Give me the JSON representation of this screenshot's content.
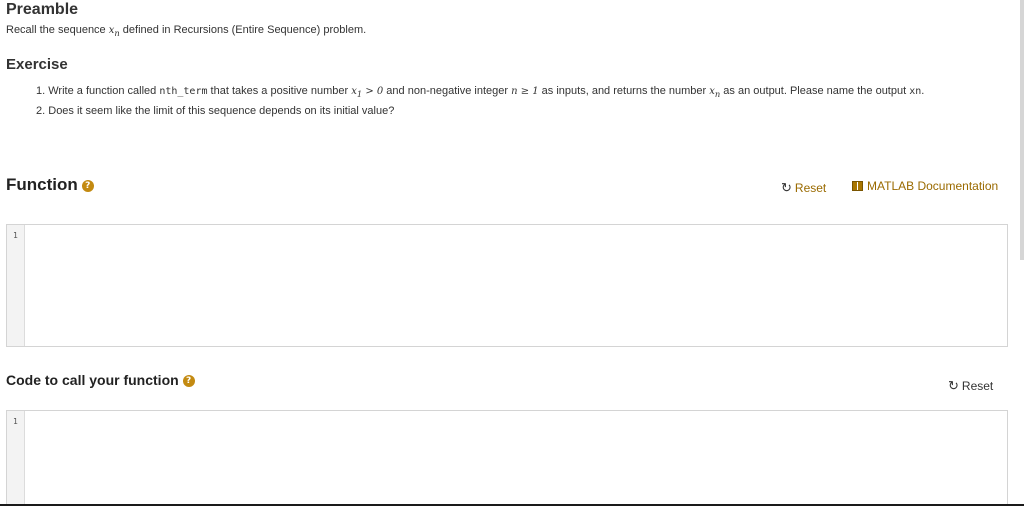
{
  "preamble": {
    "title": "Preamble",
    "text_before": "Recall the sequence ",
    "math_x": "x",
    "math_sub": "n",
    "text_after": " defined in Recursions (Entire Sequence) problem."
  },
  "exercise": {
    "title": "Exercise",
    "item1": {
      "num": "1.",
      "t1": "Write a function called ",
      "code": "nth_term",
      "t2": " that takes a positive number ",
      "m1": "x",
      "m1sub": "1",
      "m1rest": " > 0",
      "t3": " and non-negative integer ",
      "m2": "n ≥ 1",
      "t4": " as inputs, and returns the number ",
      "m3": "x",
      "m3sub": "n",
      "t5": " as an output.  Please name the output ",
      "code2": "xn",
      "t6": "."
    },
    "item2": {
      "num": "2.",
      "text": "Does it seem like the limit of this sequence depends on its initial value?"
    }
  },
  "function_section": {
    "title": "Function",
    "help": "?",
    "reset_label": "Reset",
    "doc_label": "MATLAB Documentation",
    "line_number": "1",
    "code": ""
  },
  "call_section": {
    "title": "Code to call your function",
    "help": "?",
    "reset_label": "Reset",
    "line_number": "1",
    "code": ""
  },
  "colors": {
    "link": "#9a6a00",
    "help_icon": "#c38a11"
  },
  "icons": {
    "reset": "refresh-icon",
    "doc": "book-icon",
    "help": "help-icon"
  }
}
